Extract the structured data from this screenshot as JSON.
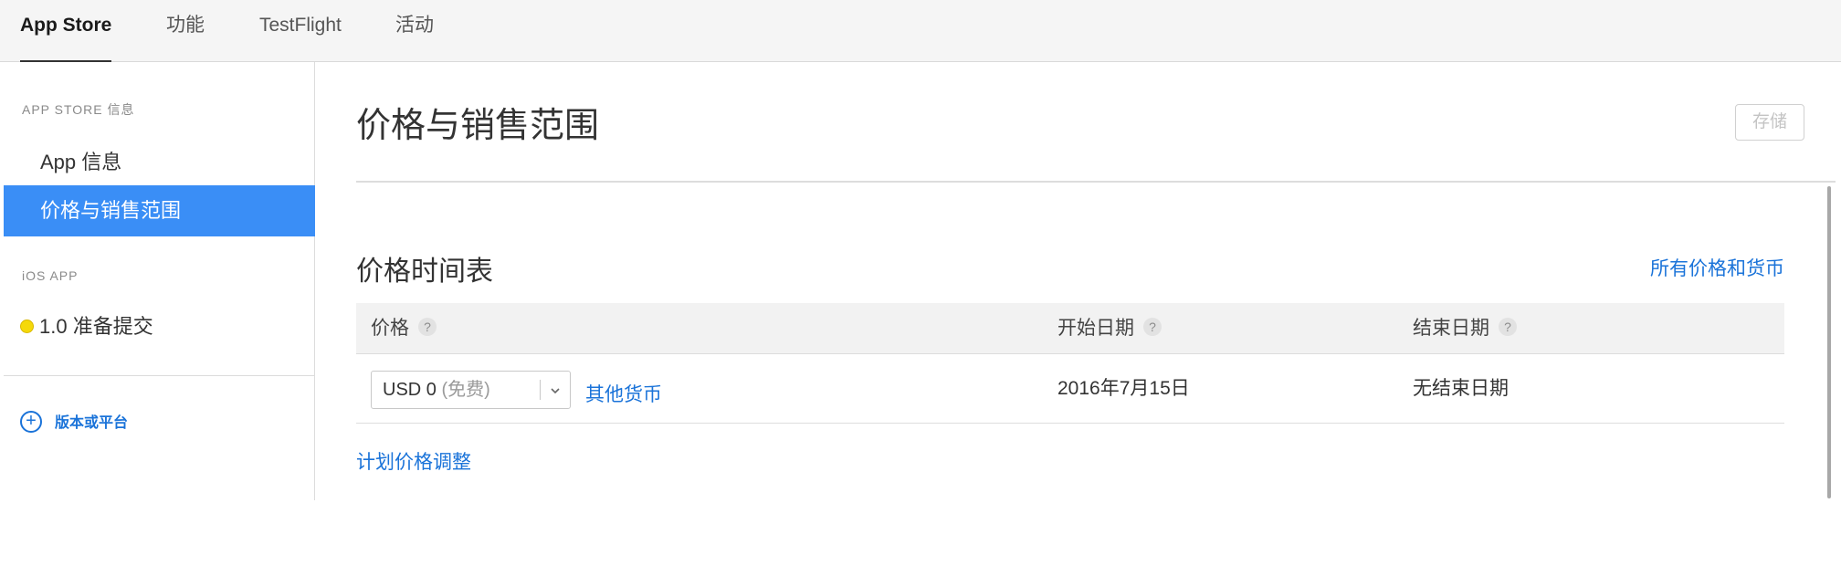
{
  "tabs": [
    {
      "label": "App Store",
      "active": true
    },
    {
      "label": "功能",
      "active": false
    },
    {
      "label": "TestFlight",
      "active": false
    },
    {
      "label": "活动",
      "active": false
    }
  ],
  "sidebar": {
    "section1_title": "APP STORE 信息",
    "items": [
      {
        "label": "App 信息",
        "selected": false
      },
      {
        "label": "价格与销售范围",
        "selected": true
      }
    ],
    "section2_title": "iOS APP",
    "version": {
      "label": "1.0 准备提交",
      "status_color": "#f5d90a"
    },
    "add_platform_label": "版本或平台",
    "add_icon": "plus-circle-icon"
  },
  "main": {
    "title": "价格与销售范围",
    "save_label": "存储",
    "section_title": "价格时间表",
    "all_prices_link": "所有价格和货币",
    "table": {
      "headers": [
        {
          "label": "价格",
          "help": "?"
        },
        {
          "label": "开始日期",
          "help": "?"
        },
        {
          "label": "结束日期",
          "help": "?"
        }
      ],
      "row": {
        "price_value": "USD 0",
        "price_note": "(免费)",
        "other_currency_link": "其他货币",
        "start_date": "2016年7月15日",
        "end_date": "无结束日期"
      }
    },
    "schedule_link": "计划价格调整"
  },
  "colors": {
    "accent": "#1a73d9",
    "selected_bg": "#3a8ef6",
    "status_yellow": "#f5d90a"
  }
}
